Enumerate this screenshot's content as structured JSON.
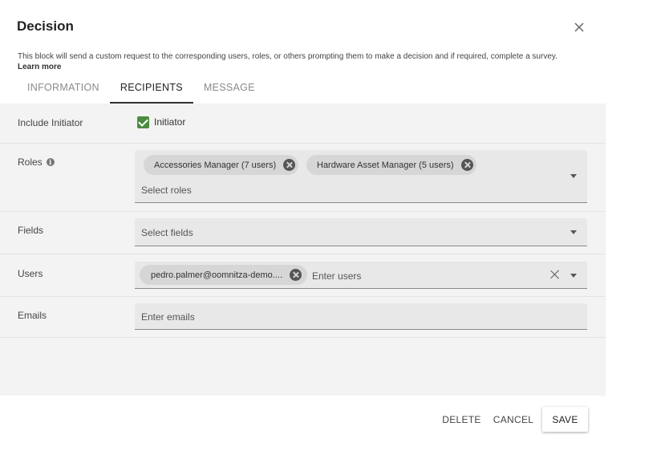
{
  "dialog": {
    "title": "Decision",
    "close_icon": "close-icon",
    "description": "This block will send a custom request to the corresponding users, roles, or others prompting them to make a decision and if required, complete a survey.",
    "learn_more": "Learn more"
  },
  "tabs": [
    {
      "label": "INFORMATION",
      "active": false
    },
    {
      "label": "RECIPIENTS",
      "active": true
    },
    {
      "label": "MESSAGE",
      "active": false
    }
  ],
  "recipients": {
    "include_initiator": {
      "label": "Include Initiator",
      "checkbox_label": "Initiator",
      "checked": true
    },
    "roles": {
      "label": "Roles",
      "info_icon": "info-icon",
      "chips": [
        "Accessories Manager (7 users)",
        "Hardware Asset Manager (5 users)"
      ],
      "placeholder": "Select roles"
    },
    "fields": {
      "label": "Fields",
      "placeholder": "Select fields"
    },
    "users": {
      "label": "Users",
      "chips": [
        "pedro.palmer@oomnitza-demo...."
      ],
      "placeholder": "Enter users"
    },
    "emails": {
      "label": "Emails",
      "placeholder": "Enter emails"
    }
  },
  "footer": {
    "delete_label": "DELETE",
    "cancel_label": "CANCEL",
    "save_label": "SAVE"
  },
  "colors": {
    "checkbox_accent": "#4a8c3e",
    "panel_bg": "#f3f3f3",
    "field_bg": "#e8e8e8"
  }
}
